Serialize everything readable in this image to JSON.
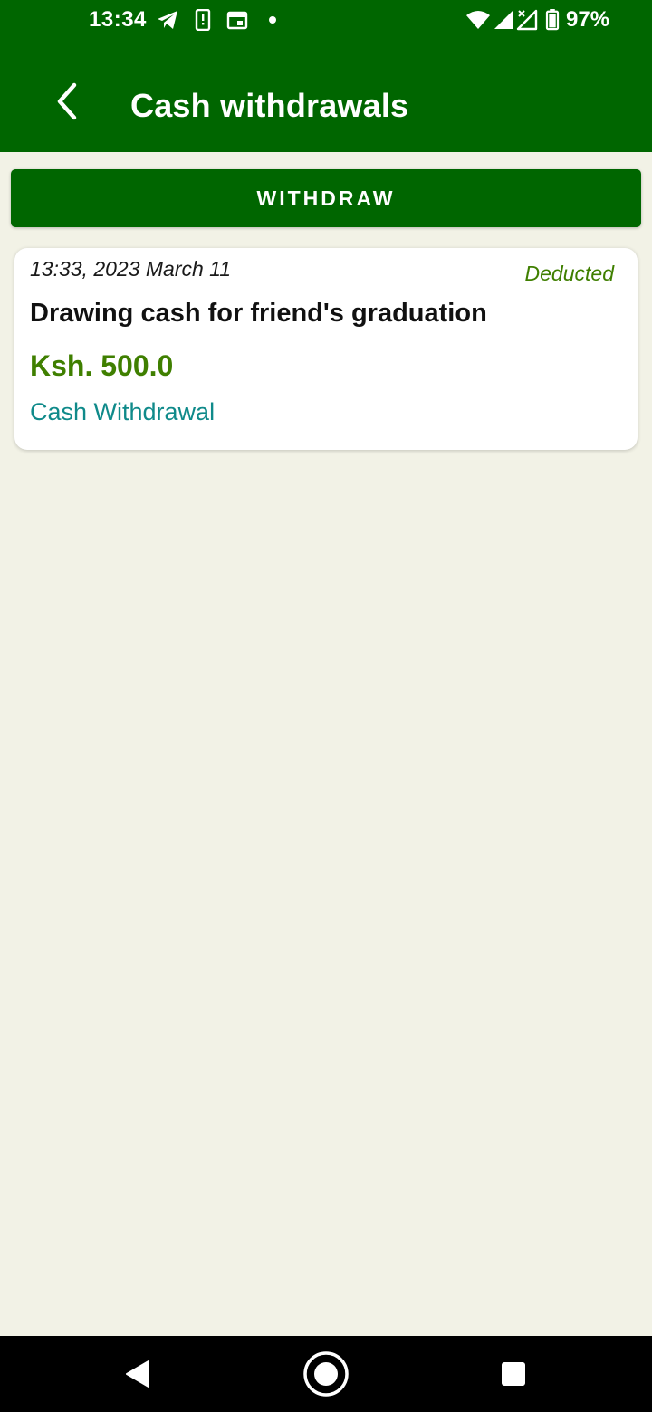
{
  "status_bar": {
    "time": "13:34",
    "battery": "97%",
    "icons": [
      "telegram-icon",
      "phone-alert-icon",
      "calendar-icon",
      "notification-dot-icon",
      "wifi-icon",
      "signal-icon",
      "signal-no-data-icon",
      "battery-icon"
    ]
  },
  "app_bar": {
    "title": "Cash withdrawals",
    "back_icon": "chevron-left-icon"
  },
  "actions": {
    "withdraw_label": "WITHDRAW"
  },
  "transactions": [
    {
      "date": "13:33, 2023 March 11",
      "status": "Deducted",
      "description": "Drawing cash for friend's graduation",
      "amount": "Ksh. 500.0",
      "category": "Cash Withdrawal"
    }
  ],
  "nav_bar": {
    "icons": [
      "back-triangle-icon",
      "home-circle-icon",
      "recents-square-icon"
    ]
  },
  "colors": {
    "primary": "#006600",
    "background": "#f2f2e6",
    "amount": "#3f7f00",
    "category": "#0f8a8a"
  }
}
